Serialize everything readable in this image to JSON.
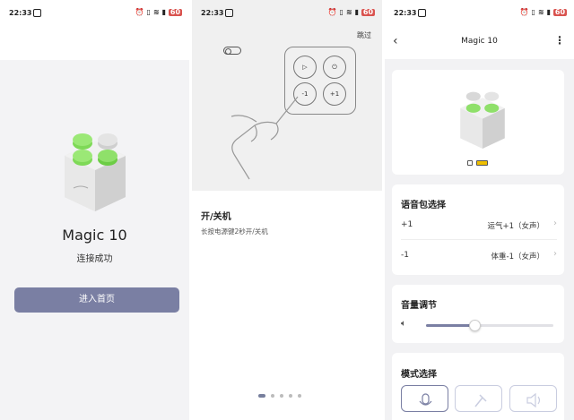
{
  "status": {
    "time": "22:33",
    "battery": "60"
  },
  "screen1": {
    "device_name": "Magic 10",
    "connected_text": "连接成功",
    "enter_button": "进入首页"
  },
  "screen2": {
    "skip": "跳过",
    "keys": {
      "play": "▷",
      "power": "⏻",
      "minus": "-1",
      "plus": "+1"
    },
    "section_title": "开/关机",
    "section_desc": "长按电源键2秒开/关机",
    "page_count": 5,
    "active_page": 1
  },
  "screen3": {
    "header_title": "Magic 10",
    "voice_pack": {
      "title": "语音包选择",
      "rows": [
        {
          "key": "+1",
          "value": "运气+1（女声）"
        },
        {
          "key": "-1",
          "value": "体重-1（女声）"
        }
      ]
    },
    "volume": {
      "title": "音量调节",
      "level": 0.38
    },
    "mode": {
      "title": "模式选择"
    }
  },
  "colors": {
    "accent": "#7a7fa3",
    "key_green": "#7ed957",
    "cube_gray": "#e3e3e3",
    "battery_red": "#d9534f"
  },
  "icons": [
    "back-icon",
    "more-icon",
    "volume-icon",
    "mic-icon",
    "hammer-icon",
    "speaker-icon",
    "chevron-right-icon",
    "toggle-icon"
  ]
}
